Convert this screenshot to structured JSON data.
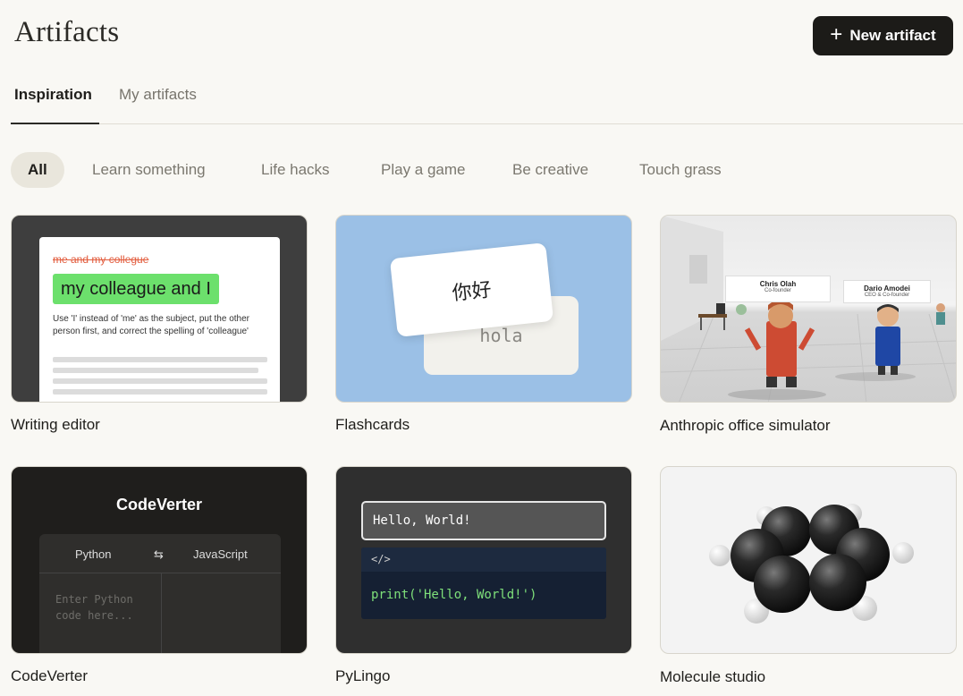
{
  "header": {
    "title": "Artifacts",
    "new_button": "New artifact"
  },
  "tabs": [
    {
      "label": "Inspiration",
      "active": true
    },
    {
      "label": "My artifacts",
      "active": false
    }
  ],
  "filters": [
    "All",
    "Learn something",
    "Life hacks",
    "Play a game",
    "Be creative",
    "Touch grass"
  ],
  "cards": {
    "writing": {
      "label": "Writing editor",
      "strike": "me and my collegue",
      "correction": "my colleague and I",
      "note": "Use 'I' instead of 'me' as the subject, put the other person first, and correct the spelling of 'colleague'"
    },
    "flashcards": {
      "label": "Flashcards",
      "front": "你好",
      "back": "hola"
    },
    "office": {
      "label": "Anthropic office simulator",
      "sign1_name": "Chris Olah",
      "sign1_role": "Co-founder",
      "sign2_name": "Dario Amodei",
      "sign2_role": "CEO & Co-founder"
    },
    "codeverter": {
      "label": "CodeVerter",
      "title": "CodeVerter",
      "from": "Python",
      "to": "JavaScript",
      "swap": "⇆",
      "placeholder": "Enter Python code here..."
    },
    "pylingo": {
      "label": "PyLingo",
      "input": "Hello, World!",
      "code_header": "</>",
      "code": "print('Hello, World!')"
    },
    "molecule": {
      "label": "Molecule studio"
    }
  },
  "colors": {
    "accent_dark": "#1c1b18",
    "highlight_green": "#6ce06c",
    "strike_red": "#e25b3c",
    "flashcard_blue": "#9bc0e6"
  }
}
